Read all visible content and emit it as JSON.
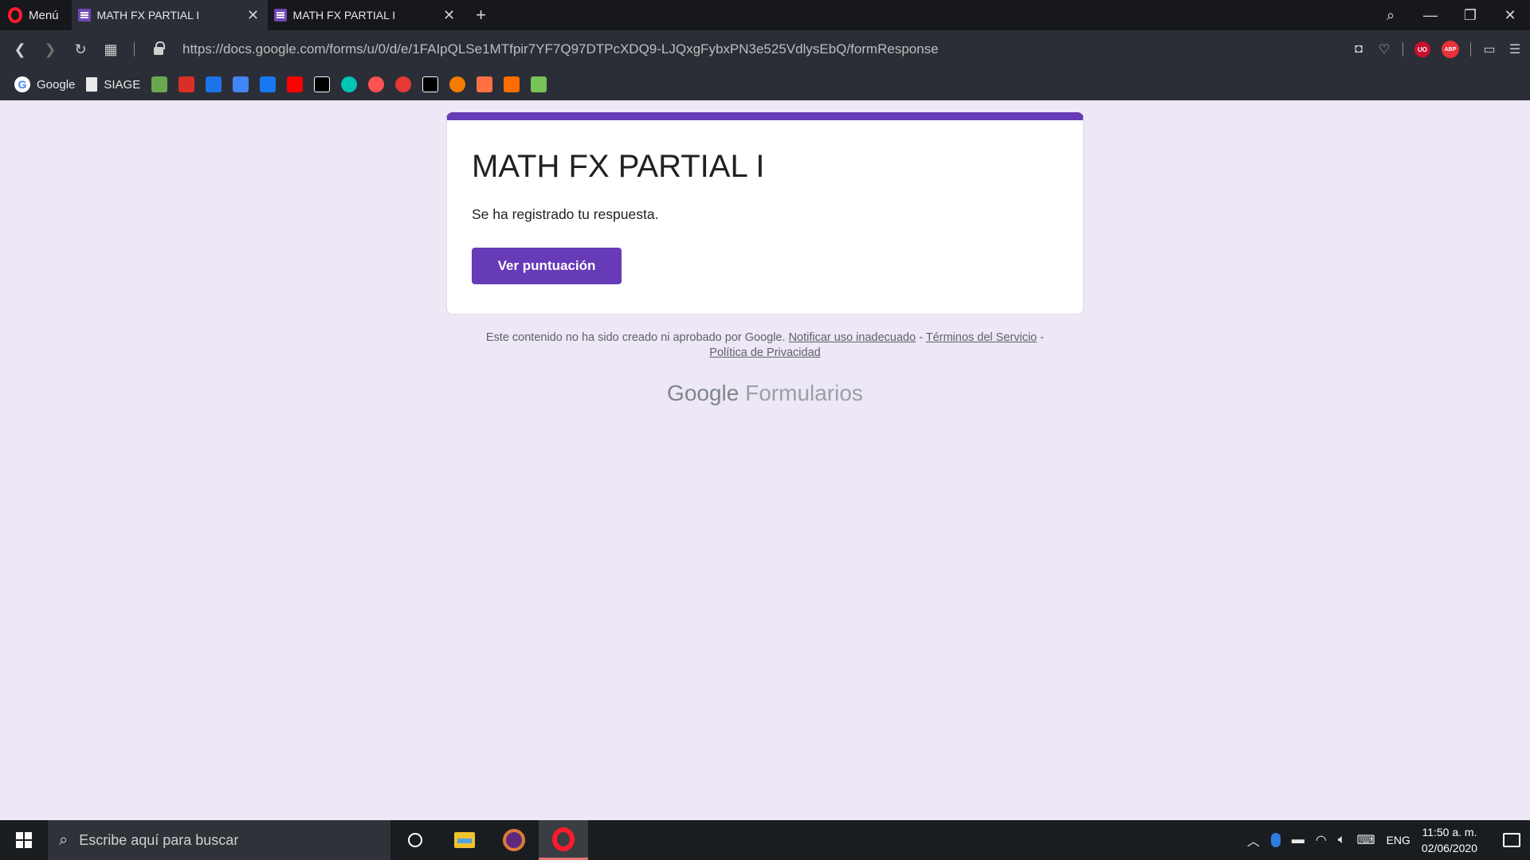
{
  "browser": {
    "menu_label": "Menú",
    "tabs": [
      {
        "title": "MATH FX PARTIAL I",
        "active": true
      },
      {
        "title": "MATH FX PARTIAL I",
        "active": false
      }
    ],
    "new_tab_label": "+",
    "window_controls": {
      "search": "search-icon",
      "minimize": "minimize-icon",
      "restore": "restore-icon",
      "close": "close-icon"
    }
  },
  "address_bar": {
    "url": "https://docs.google.com/forms/u/0/d/e/1FAIpQLSe1MTfpir7YF7Q97DTPcXDQ9-LJQxgFybxPN3e525VdlysEbQ/formResponse",
    "ext_ublock": "UO",
    "ext_abp": "ABP"
  },
  "bookmarks": [
    {
      "label": "Google",
      "icon": "google-icon"
    },
    {
      "label": "SIAGE",
      "icon": "document-icon"
    }
  ],
  "bookmark_icon_colors": [
    "#6aa84f",
    "#d93025",
    "#1a73e8",
    "#4285f4",
    "#1877f2",
    "#ff0000",
    "#000000",
    "#00c4b4",
    "#ff5252",
    "#e53935",
    "#000000",
    "#f57c00",
    "#ff7043",
    "#ff6d00",
    "#78c257"
  ],
  "form": {
    "title": "MATH FX PARTIAL I",
    "message": "Se ha registrado tu respuesta.",
    "button_label": "Ver puntuación",
    "accent": "#673ab7"
  },
  "footer": {
    "text": "Este contenido no ha sido creado ni aprobado por Google.",
    "report_link": "Notificar uso inadecuado",
    "sep1": "-",
    "terms_link": "Términos del Servicio",
    "sep2": "-",
    "privacy_link": "Política de Privacidad",
    "brand_google": "Google",
    "brand_product": "Formularios"
  },
  "taskbar": {
    "search_placeholder": "Escribe aquí para buscar",
    "language": "ENG",
    "time": "11:50 a. m.",
    "date": "02/06/2020"
  }
}
